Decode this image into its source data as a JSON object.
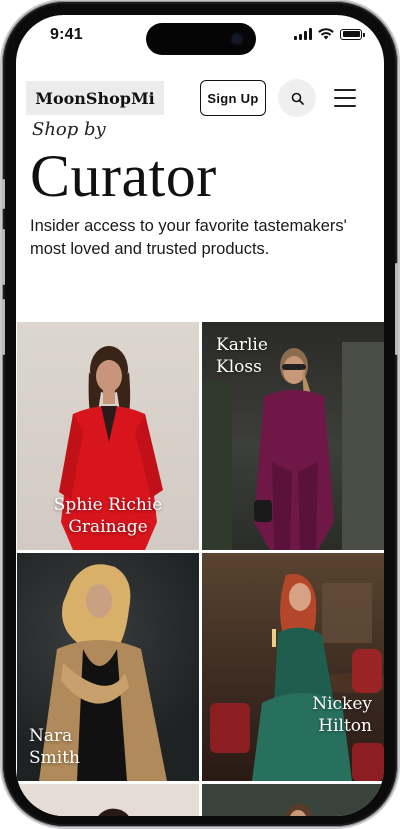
{
  "status_bar": {
    "time": "9:41",
    "icons": [
      "cellular-signal-icon",
      "wifi-icon",
      "battery-icon"
    ]
  },
  "header": {
    "logo": "MoonShopMi",
    "signup_label": "Sign Up",
    "search_icon": "search-icon",
    "menu_icon": "hamburger-menu-icon"
  },
  "hero": {
    "kicker": "Shop by",
    "title": "Curator",
    "description": "Insider access to your favorite tastemakers' most loved and trusted products."
  },
  "curators": [
    {
      "name": "Sphie Richie\nGrainage",
      "outfit_color": "#d8141c"
    },
    {
      "name": "Karlie\nKloss",
      "outfit_color": "#6f1848"
    },
    {
      "name": "Nara\nSmith",
      "outfit_color": "#b08a5a"
    },
    {
      "name": "Nickey\nHilton",
      "outfit_color": "#1f5e4f"
    },
    {
      "name": "",
      "outfit_color": "#e6dcd6"
    },
    {
      "name": "",
      "outfit_color": "#3a423c"
    }
  ],
  "colors": {
    "background": "#ffffff",
    "text": "#111111",
    "logo_bg": "#ececec",
    "search_bg": "#efefef"
  }
}
